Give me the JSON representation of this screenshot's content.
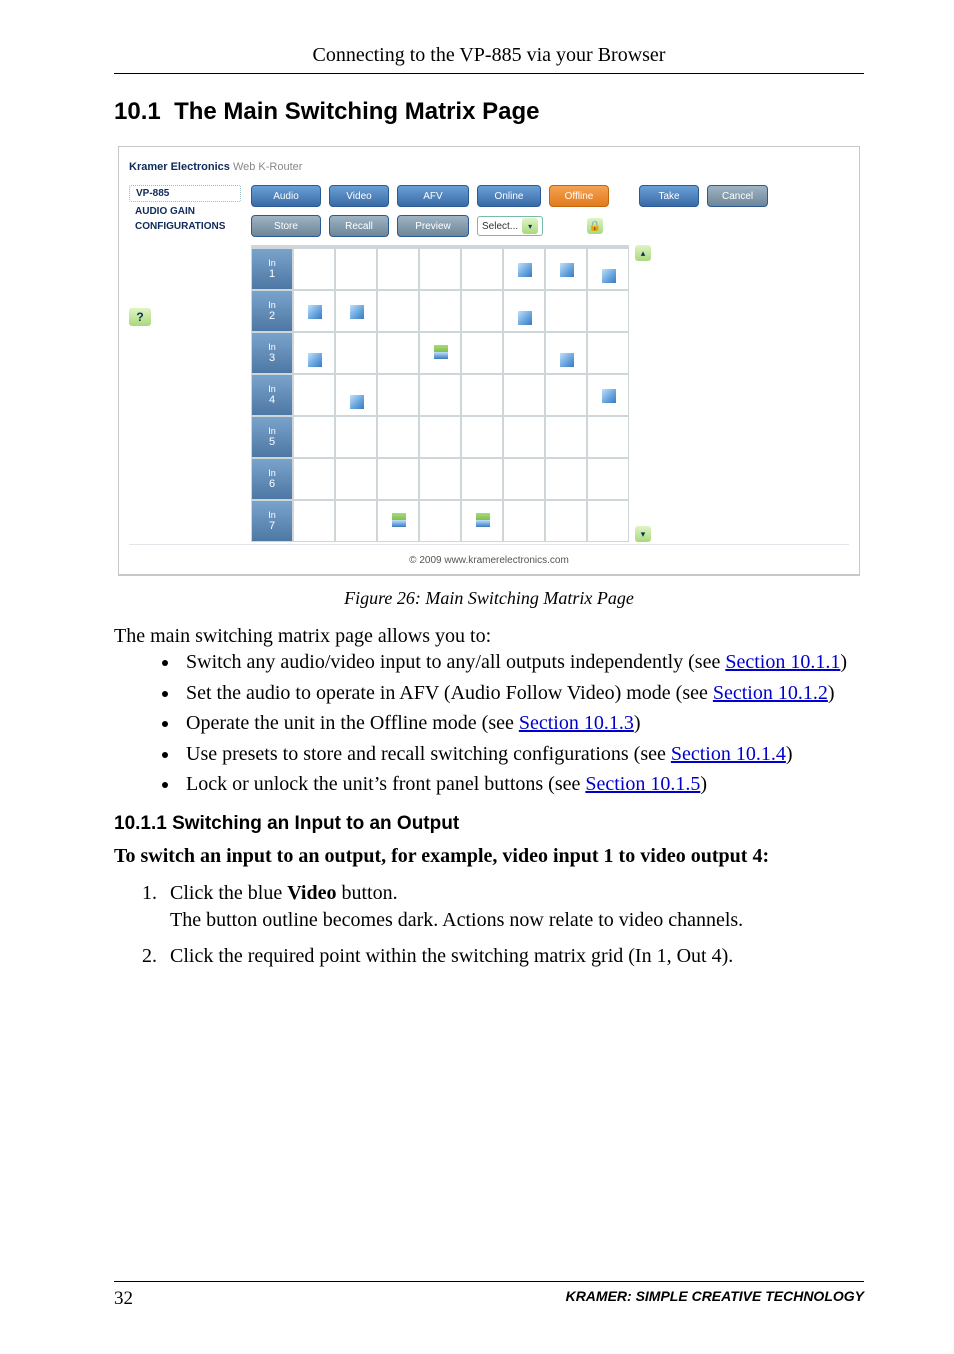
{
  "running_head": "Connecting to the VP-885 via your Browser",
  "section_number": "10.1",
  "section_title": "The Main Switching Matrix Page",
  "figure": {
    "brand_bold": "Kramer Electronics",
    "brand_light": " Web K-Router",
    "side": {
      "box": "VP-885",
      "links": [
        "AUDIO GAIN",
        "CONFIGURATIONS"
      ],
      "help": "?"
    },
    "row1_buttons": {
      "audio": "Audio",
      "video": "Video",
      "afv": "AFV",
      "online": "Online",
      "offline": "Offline",
      "take": "Take",
      "cancel": "Cancel"
    },
    "row2_buttons": {
      "store": "Store",
      "recall": "Recall",
      "preview": "Preview",
      "select": "Select..."
    },
    "row_labels": [
      "In",
      "In",
      "In",
      "In",
      "In",
      "In",
      "In"
    ],
    "row_nums": [
      "1",
      "2",
      "3",
      "4",
      "5",
      "6",
      "7"
    ],
    "copyright": "© 2009 www.kramerelectronics.com",
    "caption": "Figure 26: Main Switching Matrix Page"
  },
  "para_intro": "The main switching matrix page allows you to:",
  "bullets": [
    {
      "pre": "Switch any audio/video input to any/all outputs independently (see ",
      "link": "Section 10.1.1",
      "post": ")"
    },
    {
      "pre": "Set the audio to operate in AFV (Audio Follow Video) mode (see ",
      "link": "Section 10.1.2",
      "post": ")"
    },
    {
      "pre": "Operate the unit in the Offline mode (see ",
      "link": "Section 10.1.3",
      "post": ")"
    },
    {
      "pre": "Use presets to store and recall switching configurations (see ",
      "link": "Section 10.1.4",
      "post": ")"
    },
    {
      "pre": "Lock or unlock the unit’s front panel buttons (see ",
      "link": "Section 10.1.5",
      "post": ")"
    }
  ],
  "sub_number": "10.1.1",
  "sub_title": "Switching an Input to an Output",
  "lead": "To switch an input to an output, for example, video input 1 to video output 4:",
  "steps": [
    {
      "a": "Click the blue ",
      "bold": "Video",
      "b": " button.",
      "second": "The button outline becomes dark. Actions now relate to video channels."
    },
    {
      "a": "Click the required point within the switching matrix grid (In 1, Out 4).",
      "bold": "",
      "b": "",
      "second": ""
    }
  ],
  "footer": {
    "page": "32",
    "tag": "KRAMER:  SIMPLE CREATIVE TECHNOLOGY"
  }
}
